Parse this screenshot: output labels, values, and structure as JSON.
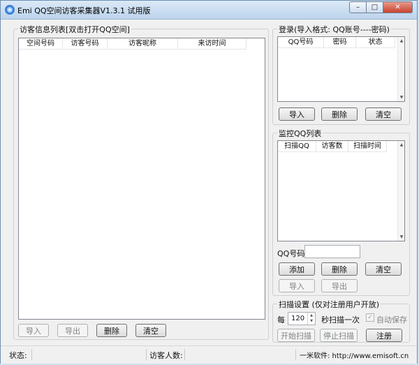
{
  "window": {
    "title": "Emi QQ空间访客采集器V1.3.1 试用版",
    "controls": {
      "minimize": "–",
      "maximize": "□",
      "close": "✕"
    }
  },
  "visitor_panel": {
    "title": "访客信息列表[双击打开QQ空间]",
    "columns": [
      "空间号码",
      "访客号码",
      "访客昵称",
      "来访时间"
    ],
    "buttons": {
      "import": "导入",
      "export": "导出",
      "delete": "删除",
      "clear": "清空"
    }
  },
  "login_panel": {
    "title": "登录(导入格式: QQ账号----密码)",
    "columns": [
      "QQ号码",
      "密码",
      "状态"
    ],
    "buttons": {
      "import": "导入",
      "delete": "删除",
      "clear": "清空"
    }
  },
  "monitor_panel": {
    "title": "监控QQ列表",
    "columns": [
      "扫描QQ",
      "访客数",
      "扫描时间"
    ],
    "qq_label": "QQ号码:",
    "qq_value": "",
    "buttons": {
      "add": "添加",
      "delete": "删除",
      "clear": "清空",
      "import": "导入",
      "export": "导出"
    }
  },
  "scan_panel": {
    "title": "扫描设置 (仅对注册用户开放)",
    "every_label": "每",
    "interval_value": "120",
    "interval_suffix": "秒扫描一次",
    "auto_save_label": "自动保存",
    "auto_save_checked": true,
    "buttons": {
      "start": "开始扫描",
      "stop": "停止扫描",
      "register": "注册"
    }
  },
  "statusbar": {
    "status_label": "状态:",
    "visitors_label": "访客人数:",
    "company": "一米软件: http://www.emisoft.cn"
  },
  "icons": {
    "app": "app-logo-icon",
    "scroll_up": "▲",
    "scroll_down": "▼",
    "checkmark": "✓"
  }
}
